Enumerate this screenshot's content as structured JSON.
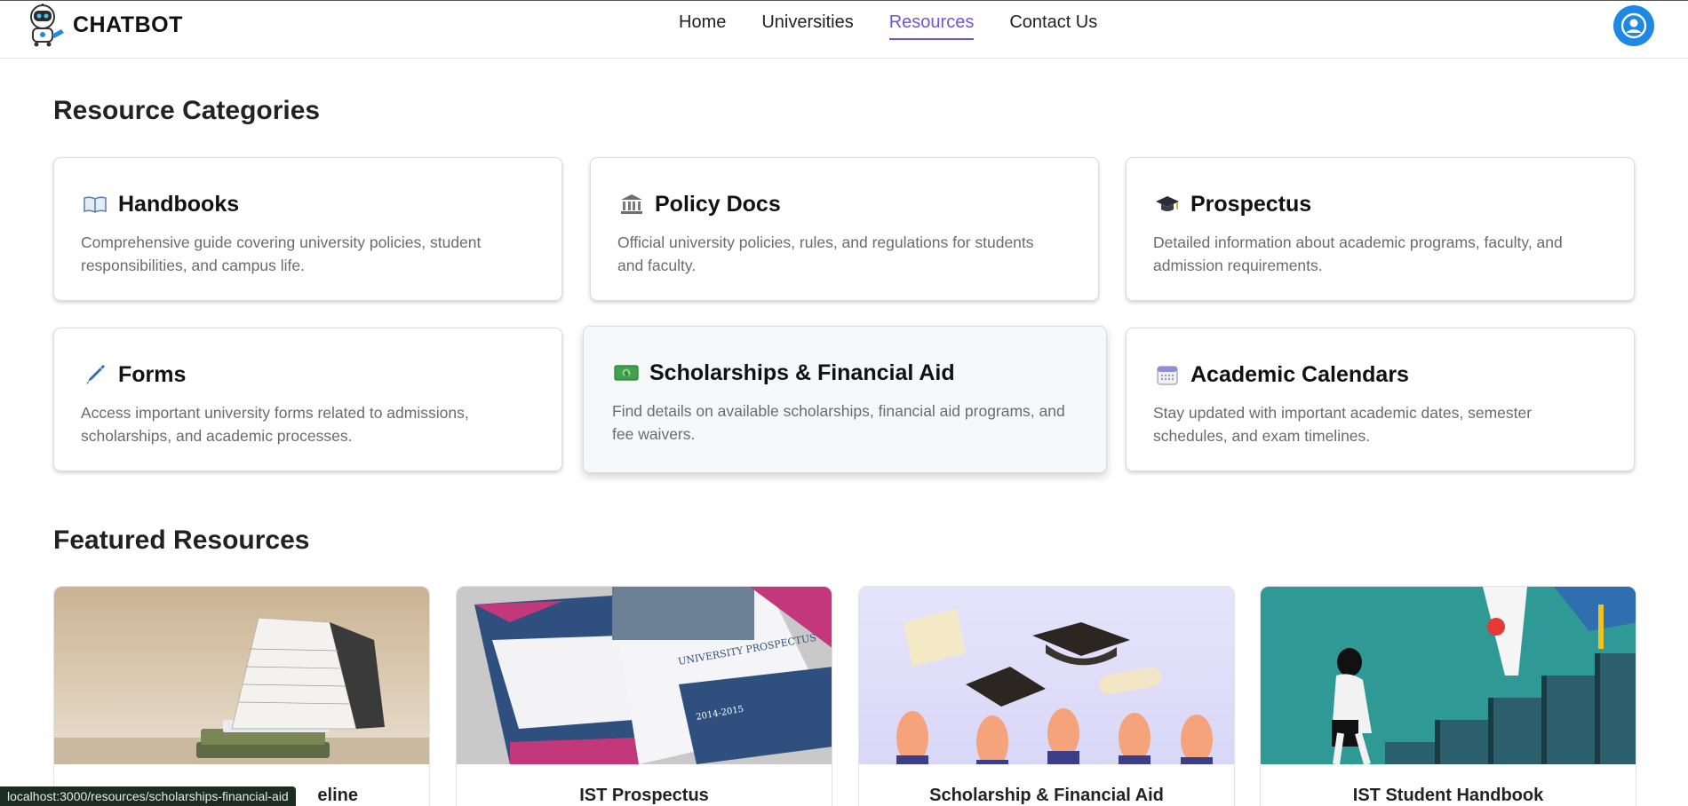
{
  "brand": {
    "name": "CHATBOT"
  },
  "nav": {
    "items": [
      {
        "label": "Home",
        "active": false
      },
      {
        "label": "Universities",
        "active": false
      },
      {
        "label": "Resources",
        "active": true
      },
      {
        "label": "Contact Us",
        "active": false
      }
    ],
    "accent_color": "#6a5acd"
  },
  "user": {
    "avatar_icon": "user-circle-icon",
    "avatar_color": "#1e88e5"
  },
  "categories": {
    "title": "Resource Categories",
    "items": [
      {
        "icon": "open-book-icon",
        "title": "Handbooks",
        "description": "Comprehensive guide covering university policies, student responsibilities, and campus life."
      },
      {
        "icon": "classical-building-icon",
        "title": "Policy Docs",
        "description": "Official university policies, rules, and regulations for students and faculty."
      },
      {
        "icon": "graduation-cap-icon",
        "title": "Prospectus",
        "description": "Detailed information about academic programs, faculty, and admission requirements."
      },
      {
        "icon": "pen-icon",
        "title": "Forms",
        "description": "Access important university forms related to admissions, scholarships, and academic processes."
      },
      {
        "icon": "dollar-banknote-icon",
        "title": "Scholarships & Financial Aid",
        "description": "Find details on available scholarships, financial aid programs, and fee waivers."
      },
      {
        "icon": "calendar-icon",
        "title": "Academic Calendars",
        "description": "Stay updated with important academic dates, semester schedules, and exam timelines."
      }
    ]
  },
  "featured": {
    "title": "Featured Resources",
    "items": [
      {
        "title": "eline",
        "image": "desk-calendar-image"
      },
      {
        "title": "IST Prospectus",
        "image": "prospectus-brochure-image"
      },
      {
        "title": "Scholarship & Financial Aid",
        "image": "graduation-caps-hands-image"
      },
      {
        "title": "IST Student Handbook",
        "image": "stairs-graduation-image"
      }
    ]
  },
  "status_url": "localhost:3000/resources/scholarships-financial-aid"
}
